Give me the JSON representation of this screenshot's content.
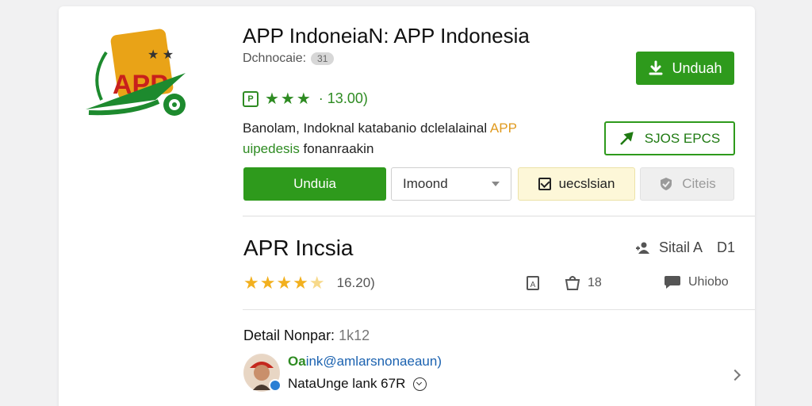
{
  "app": {
    "title": "APP IndoneiaN: APP Indonesia",
    "developer": "Dchnocaie:",
    "developer_badge": "31",
    "logo_text": "APP",
    "rating_tag": "P",
    "rating_value": "· 13.00)",
    "description_part1": "Banolam, Indoknal katabanio dclelalainal ",
    "description_highlight_orange": "APP",
    "description_highlight_green": "uipedesis",
    "description_part2": " fonanraakin",
    "colors": {
      "accent_green": "#2e9a1c",
      "star_gold": "#f2b01e",
      "highlight_orange": "#e09a1e",
      "wishlist_bg": "#fdf7d8"
    }
  },
  "actions": {
    "top_download": "Unduah",
    "outline_button": "SJOS EPCS",
    "install": "Unduia",
    "select_value": "Imoond",
    "wishlist": "uecslsian",
    "disabled": "Citeis"
  },
  "section": {
    "title": "APR Incsia",
    "share_label": "Sitail A",
    "share_count": "D1",
    "stars_count": "16.20)",
    "meta_downloads_icon": "A",
    "meta_reviews": "18",
    "meta_update": "Uhiobo",
    "detail_label": "Detail Nonpar:",
    "detail_number": "1k12"
  },
  "review": {
    "user_prefix": "Oa",
    "user_rest": "ink@amlarsnonaeaun)",
    "meta": "NataUnge lank 67R"
  }
}
